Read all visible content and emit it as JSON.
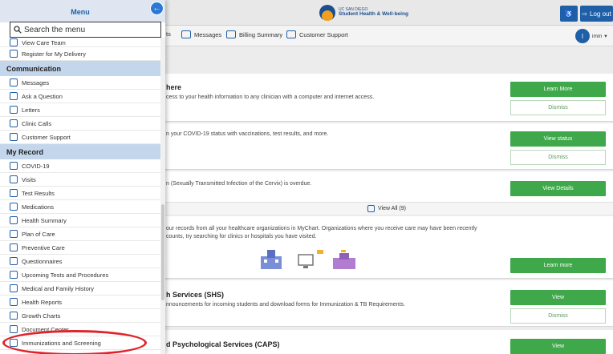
{
  "menu": {
    "title": "Menu",
    "search_placeholder": "Search the menu",
    "top_items": [
      {
        "label": "View Care Team",
        "icon": "care-team-icon"
      },
      {
        "label": "Register for My Delivery",
        "icon": "delivery-icon"
      }
    ],
    "sections": [
      {
        "title": "Communication",
        "items": [
          {
            "label": "Messages",
            "icon": "envelope-icon"
          },
          {
            "label": "Ask a Question",
            "icon": "chat-icon"
          },
          {
            "label": "Letters",
            "icon": "letters-icon"
          },
          {
            "label": "Clinic Calls",
            "icon": "phone-icon"
          },
          {
            "label": "Customer Support",
            "icon": "support-icon"
          }
        ]
      },
      {
        "title": "My Record",
        "items": [
          {
            "label": "COVID-19",
            "icon": "virus-icon"
          },
          {
            "label": "Visits",
            "icon": "calendar-icon"
          },
          {
            "label": "Test Results",
            "icon": "flask-icon"
          },
          {
            "label": "Medications",
            "icon": "pills-icon"
          },
          {
            "label": "Health Summary",
            "icon": "heart-icon"
          },
          {
            "label": "Plan of Care",
            "icon": "clipboard-icon"
          },
          {
            "label": "Preventive Care",
            "icon": "shield-icon"
          },
          {
            "label": "Questionnaires",
            "icon": "checklist-icon"
          },
          {
            "label": "Upcoming Tests and Procedures",
            "icon": "calendar-icon"
          },
          {
            "label": "Medical and Family History",
            "icon": "family-icon"
          },
          {
            "label": "Health Reports",
            "icon": "report-icon"
          },
          {
            "label": "Growth Charts",
            "icon": "growth-icon"
          },
          {
            "label": "Document Center",
            "icon": "document-icon"
          },
          {
            "label": "Immunizations and Screening",
            "icon": "syringe-icon"
          }
        ]
      }
    ]
  },
  "header": {
    "logo_line1": "UC SAN DIEGO",
    "logo_line2": "Student Health & Well-being",
    "logout_label": "Log out",
    "user_name": "imm",
    "avatar_initial": "I"
  },
  "nav": {
    "items": [
      {
        "label": "ts"
      },
      {
        "label": "Messages"
      },
      {
        "label": "Billing Summary"
      },
      {
        "label": "Customer Support"
      }
    ]
  },
  "cards": [
    {
      "title": "here",
      "text": "cess to your health information to any clinician with a computer and internet access.",
      "primary": "Learn More",
      "secondary": "Dismiss"
    },
    {
      "title": "",
      "text": "n your COVID-19 status with vaccinations, test results, and more.",
      "primary": "View status",
      "secondary": "Dismiss"
    },
    {
      "title": "",
      "text": "n (Sexually Transmitted Infection of the Cervix) is overdue.",
      "primary": "View Details",
      "view_all": "View All (9)"
    },
    {
      "title": "",
      "text1": "our records from all your healthcare organizations in MyChart. Organizations where you receive care may have been recently",
      "text2": "counts, try searching for clinics or hospitals you have visited.",
      "primary": "Learn more"
    },
    {
      "title": "h Services (SHS)",
      "text": "nnouncements for incoming students and download forms for Immunization & TB Requirements.",
      "primary": "View",
      "secondary": "Dismiss"
    },
    {
      "title": "d Psychological Services (CAPS)",
      "primary": "View"
    }
  ],
  "colors": {
    "primary_blue": "#1f5fa8",
    "action_green": "#3ea84a",
    "section_bg": "#c4d6ec",
    "highlight_red": "#e0232a"
  }
}
